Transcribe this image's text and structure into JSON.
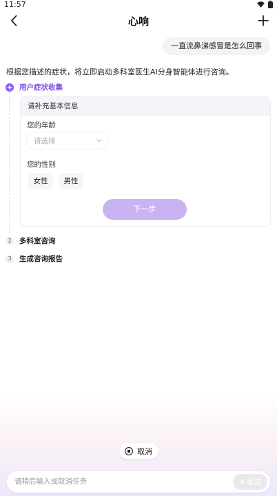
{
  "status_bar": {
    "time": "11:57"
  },
  "header": {
    "title": "心响"
  },
  "chat": {
    "user_message": "一直流鼻涕感冒是怎么回事",
    "assistant_intro": "根据您描述的症状，将立即启动多科室医生AI分身智能体进行咨询。"
  },
  "steps": [
    {
      "label": "用户症状收集"
    },
    {
      "num": "2",
      "label": "多科室咨询"
    },
    {
      "num": "3",
      "label": "生成咨询报告"
    }
  ],
  "form": {
    "title": "请补充基本信息",
    "age_label": "您的年龄",
    "age_placeholder": "请选择",
    "gender_label": "您的性别",
    "gender_options": [
      "女性",
      "男性"
    ],
    "next_label": "下一步"
  },
  "bottom": {
    "cancel_label": "取消",
    "input_placeholder": "请稍后输入或取消任务",
    "send_label": "发送"
  },
  "colors": {
    "accent": "#8b5cf6",
    "next_button": "#c8b3f3"
  }
}
